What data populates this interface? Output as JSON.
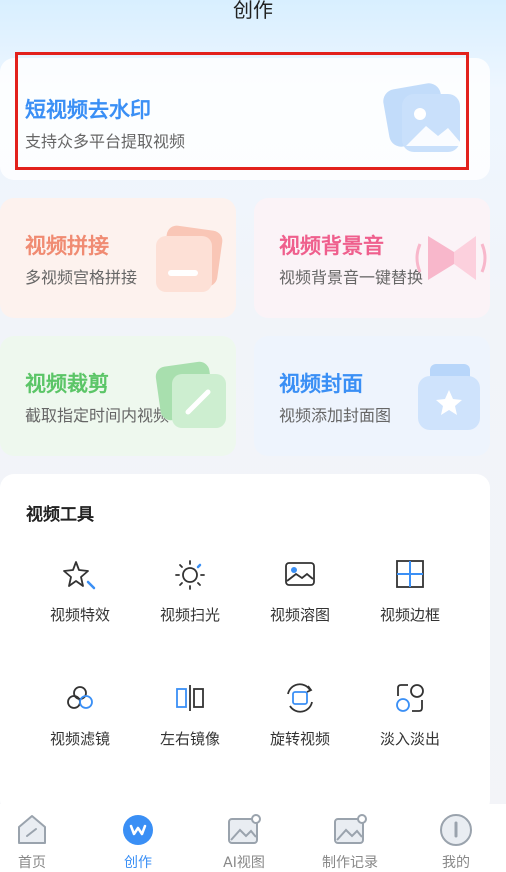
{
  "page_title": "创作",
  "hero": {
    "title": "短视频去水印",
    "subtitle": "支持众多平台提取视频",
    "icon": "image-icon"
  },
  "feature_cards": [
    {
      "title": "视频拼接",
      "subtitle": "多视频宫格拼接",
      "color": "#f08b72",
      "icon": "stack-icon"
    },
    {
      "title": "视频背景音",
      "subtitle": "视频背景音一键替换",
      "color": "#ef5f8d",
      "icon": "speaker-icon"
    },
    {
      "title": "视频裁剪",
      "subtitle": "截取指定时间内视频",
      "color": "#5bc567",
      "icon": "edit-icon"
    },
    {
      "title": "视频封面",
      "subtitle": "视频添加封面图",
      "color": "#3a8ff5",
      "icon": "cover-icon"
    }
  ],
  "tools": {
    "title": "视频工具",
    "items": [
      {
        "label": "视频特效",
        "icon": "star-sparkle-icon"
      },
      {
        "label": "视频扫光",
        "icon": "sun-icon"
      },
      {
        "label": "视频溶图",
        "icon": "picture-icon"
      },
      {
        "label": "视频边框",
        "icon": "grid-frame-icon"
      },
      {
        "label": "视频滤镜",
        "icon": "filter-circles-icon"
      },
      {
        "label": "左右镜像",
        "icon": "mirror-icon"
      },
      {
        "label": "旋转视频",
        "icon": "rotate-icon"
      },
      {
        "label": "淡入淡出",
        "icon": "fade-icon"
      }
    ]
  },
  "tabbar": [
    {
      "label": "首页",
      "icon": "home-icon",
      "active": false
    },
    {
      "label": "创作",
      "icon": "create-icon",
      "active": true
    },
    {
      "label": "AI视图",
      "icon": "ai-image-icon",
      "active": false
    },
    {
      "label": "制作记录",
      "icon": "records-icon",
      "active": false
    },
    {
      "label": "我的",
      "icon": "profile-icon",
      "active": false
    }
  ],
  "colors": {
    "accent": "#3a8ff5",
    "highlight_border": "#e2211c"
  }
}
